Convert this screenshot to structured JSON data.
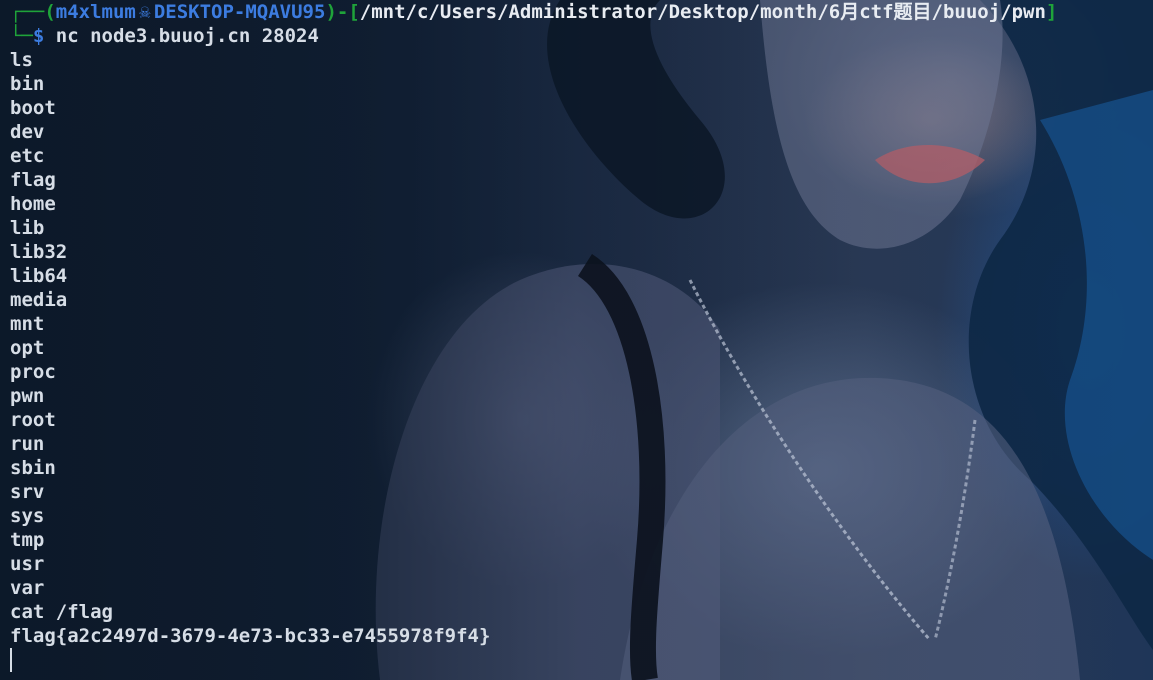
{
  "prompt": {
    "corner_top": "┌──(",
    "user": "m4xlmum",
    "host_icon": "skull-icon",
    "host": "DESKTOP-MQAVU95",
    "sep": ")-[",
    "cwd": "/mnt/c/Users/Administrator/Desktop/month/6月ctf题目/buuoj/pwn",
    "close": "]",
    "corner_bottom": "└─",
    "dollar": "$",
    "command": "nc node3.buuoj.cn 28024"
  },
  "output_lines": [
    "ls",
    "bin",
    "boot",
    "dev",
    "etc",
    "flag",
    "home",
    "lib",
    "lib32",
    "lib64",
    "media",
    "mnt",
    "opt",
    "proc",
    "pwn",
    "root",
    "run",
    "sbin",
    "srv",
    "sys",
    "tmp",
    "usr",
    "var",
    "cat /flag",
    "flag{a2c2497d-3679-4e73-bc33-e7455978f9f4}"
  ],
  "colors": {
    "prompt_green": "#1fa33a",
    "prompt_blue": "#3c7ce0",
    "text": "#d6dde6"
  }
}
